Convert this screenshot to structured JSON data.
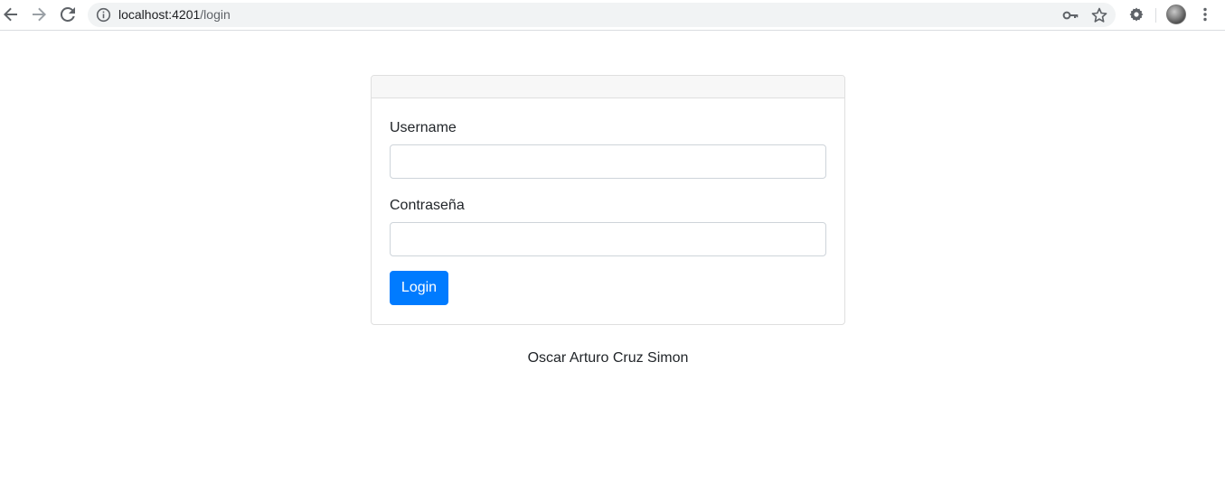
{
  "browser": {
    "url_host": "localhost:4201",
    "url_path": "/login",
    "icons": {
      "back": "arrow-left-icon",
      "forward": "arrow-right-icon",
      "reload": "reload-icon",
      "info": "info-icon",
      "key": "key-icon",
      "star": "star-icon",
      "extension": "gear-icon",
      "profile": "avatar",
      "menu": "kebab-menu-icon"
    }
  },
  "login_form": {
    "username_label": "Username",
    "username_value": "",
    "password_label": "Contraseña",
    "password_value": "",
    "submit_label": "Login"
  },
  "footer": {
    "author": "Oscar Arturo Cruz Simon"
  },
  "colors": {
    "primary": "#007bff",
    "card_header_bg": "#f7f7f7",
    "border": "#dfdfdf"
  }
}
